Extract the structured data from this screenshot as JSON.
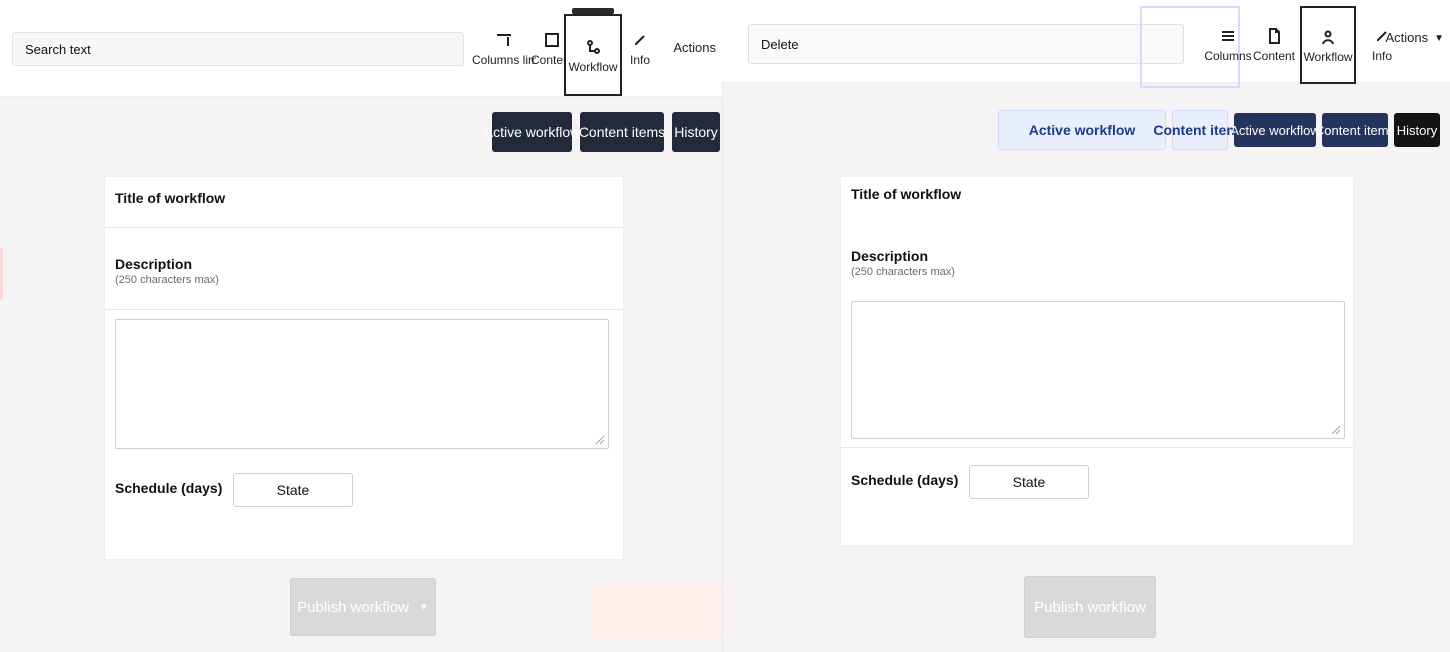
{
  "left": {
    "search": {
      "placeholder": "Search text"
    },
    "toolbar": [
      {
        "id": "columns",
        "label": "Columns limited",
        "icon": "columns-icon"
      },
      {
        "id": "content",
        "label": "Content",
        "icon": "square-icon"
      },
      {
        "id": "workflow",
        "label": "Workflow",
        "icon": "workflow-icon",
        "active": true
      },
      {
        "id": "info",
        "label": "Info",
        "icon": "pen-icon"
      }
    ],
    "author": "Actions",
    "tabs": [
      {
        "label": "Active workflow",
        "style": "dark"
      },
      {
        "label": "Content items",
        "style": "dark"
      },
      {
        "label": "History",
        "style": "dark"
      }
    ],
    "form": {
      "title_label": "Title of workflow",
      "title_value": "",
      "desc_label": "Description",
      "desc_help": "(250 characters max)",
      "desc_value": "",
      "schedule_label": "Schedule (days)",
      "schedule_value": "State",
      "schedule_right_hint": ""
    },
    "bottom": {
      "primary": "Publish workflow",
      "secondary": ""
    }
  },
  "right": {
    "search": {
      "placeholder": "Delete"
    },
    "toolbar": [
      {
        "id": "list",
        "label": "Columns",
        "icon": "list-icon"
      },
      {
        "id": "doc",
        "label": "Content",
        "icon": "doc-icon"
      },
      {
        "id": "user",
        "label": "Workflow",
        "icon": "user-icon",
        "active": true
      },
      {
        "id": "pen",
        "label": "Info",
        "icon": "pen-icon"
      }
    ],
    "author": "Actions",
    "tabs": [
      {
        "label": "Active workflow",
        "style": "soft"
      },
      {
        "label": "Content items",
        "style": "soft2"
      },
      {
        "label": "Active workflow",
        "style": "navy"
      },
      {
        "label": "Content items",
        "style": "navy"
      },
      {
        "label": "History",
        "style": "black"
      }
    ],
    "form": {
      "title_label": "Title of workflow",
      "desc_label": "Description",
      "desc_help": "(250 characters max)",
      "schedule_label": "Schedule (days)",
      "schedule_value": "State"
    },
    "bottom": {
      "primary": "Publish workflow"
    }
  },
  "colors": {
    "dark": "#232a3a",
    "navy": "#24345f",
    "soft": "#e9eefc",
    "accent": "#1a63ff"
  }
}
